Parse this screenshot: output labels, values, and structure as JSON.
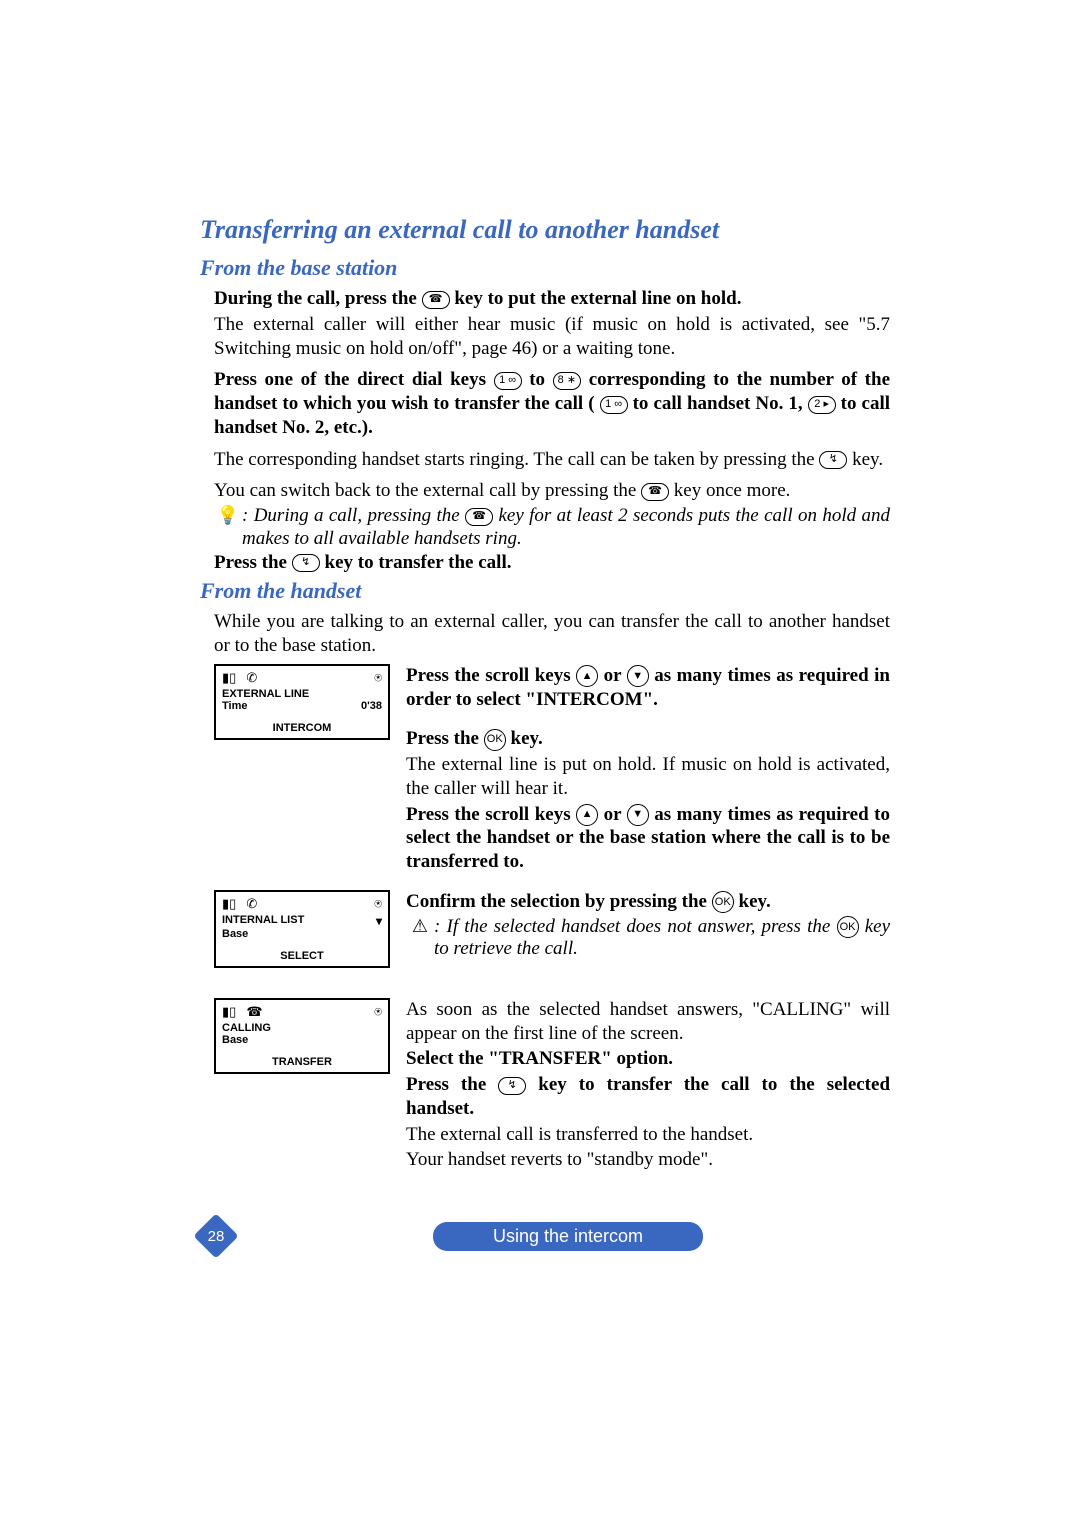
{
  "title": "Transferring an external call to another handset",
  "section1": {
    "heading": "From the base station",
    "p1a": "During the call, press the ",
    "p1b": " key to put the external line on hold.",
    "p2": "The external caller will either hear music (if music on hold is activated, see \"5.7 Switching music on hold on/off\", page 46) or a waiting tone.",
    "p3a": "Press one of the direct dial keys ",
    "p3b": " to ",
    "p3c": " corresponding to the number of the handset to which you wish to transfer the call (",
    "p3d": " to call handset No. 1, ",
    "p3e": " to call handset No. 2, etc.).",
    "p4a": "The corresponding handset starts ringing. The call can be taken by pressing the ",
    "p4b": " key.",
    "p5a": "You can switch back to the external call by pressing the ",
    "p5b": " key once more.",
    "tip_a": ": During a call, pressing the ",
    "tip_b": " key for at least 2 seconds puts the call on hold and makes to all available handsets ring.",
    "p6a": "Press the ",
    "p6b": " key to transfer the call."
  },
  "section2": {
    "heading": "From the handset",
    "intro": "While you are talking to an external caller, you can transfer the call to another handset or to the base station.",
    "step1": {
      "lcd": {
        "line1_left": "EXTERNAL LINE",
        "line1_right": "",
        "line2_left": "Time",
        "line2_right": "0'38",
        "soft": "INTERCOM"
      },
      "b1a": "Press the scroll keys ",
      "b1b": " or ",
      "b1c": " as many times as required in order to select  \"INTERCOM\".",
      "b2a": "Press the ",
      "b2b": " key.",
      "p1": "The external line is put on hold. If music on hold is activated, the caller will hear it.",
      "b3a": "Press the scroll keys ",
      "b3b": " or ",
      "b3c": " as many times as required to select the handset or the base station where the call is to be transferred to."
    },
    "step2": {
      "lcd": {
        "line1_left": "INTERNAL LIST",
        "line1_right": "▾",
        "line2_left": "Base",
        "line2_right": "",
        "soft": "SELECT"
      },
      "b1a": "Confirm the selection by pressing the ",
      "b1b": " key.",
      "warn_a": ": If the selected handset does not answer, press the ",
      "warn_b": " key to retrieve the call."
    },
    "step3": {
      "lcd": {
        "line1_left": "CALLING",
        "line1_right": "",
        "line2_left": "Base",
        "line2_right": "",
        "soft": "TRANSFER"
      },
      "p1": "As soon as the selected handset answers, \"CALLING\" will appear on the first line of the screen.",
      "b1": "Select the \"TRANSFER\" option.",
      "b2a": "Press the ",
      "b2b": " key to transfer the call to the selected handset.",
      "p2": "The external call is transferred to the handset.",
      "p3": "Your handset reverts to \"standby mode\"."
    }
  },
  "keys": {
    "intercom": "☎",
    "one": "1 ∞",
    "two": "2 ▸",
    "eight": "8 ∗",
    "hook": "↯",
    "up": "▲",
    "down": "▼",
    "ok": "OK"
  },
  "icons": {
    "battery": "▮▯",
    "handset": "✆",
    "antenna": "⍟",
    "intercom_handset": "☎",
    "bulb": "💡",
    "warn": "⚠"
  },
  "footer": {
    "page": "28",
    "label": "Using the intercom"
  }
}
